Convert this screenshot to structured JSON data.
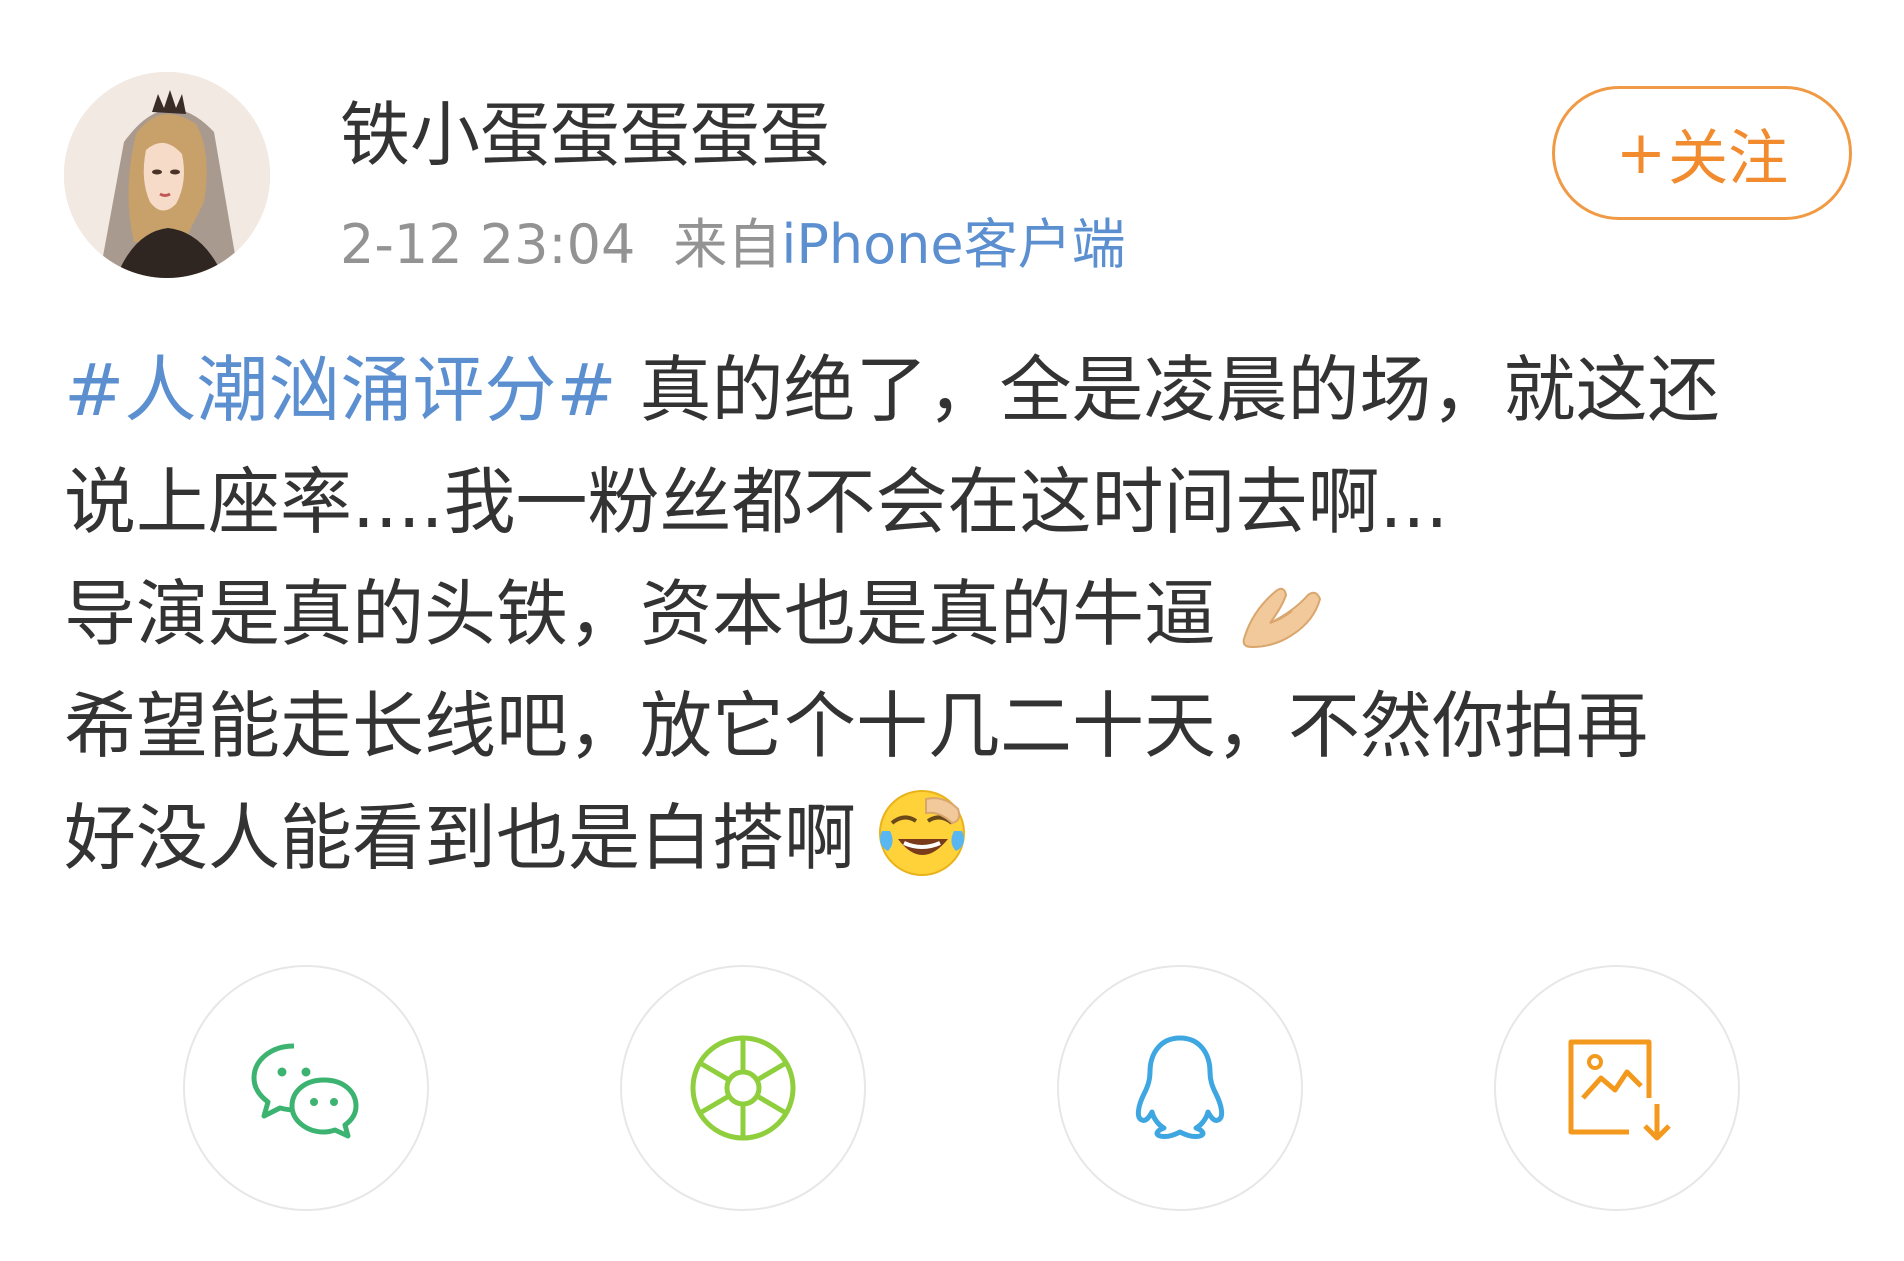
{
  "post": {
    "author": "铁小蛋蛋蛋蛋蛋",
    "time": "2-12 23:04",
    "from_label": "来自",
    "source": "iPhone客户端",
    "follow_label": "关注",
    "follow_plus": "+",
    "hashtag": "#人潮汹涌评分#",
    "lines": [
      " 真的绝了，全是凌晨的场，就这还",
      "说上座率....我一粉丝都不会在这时间去啊...",
      "导演是真的头铁，资本也是真的牛逼",
      "希望能走长线吧，放它个十几二十天，不然你拍再",
      "好没人能看到也是白搭啊"
    ]
  },
  "share": {
    "items": [
      {
        "icon": "wechat-icon",
        "color": "#3cb371"
      },
      {
        "icon": "moments-icon",
        "color": "#8fce3c"
      },
      {
        "icon": "qq-icon",
        "color": "#3ea6e0"
      },
      {
        "icon": "save-image-icon",
        "color": "#f39a1e"
      }
    ]
  },
  "colors": {
    "link": "#5b8fd0",
    "accent": "#f18b2d",
    "text": "#333333",
    "muted": "#939393"
  }
}
